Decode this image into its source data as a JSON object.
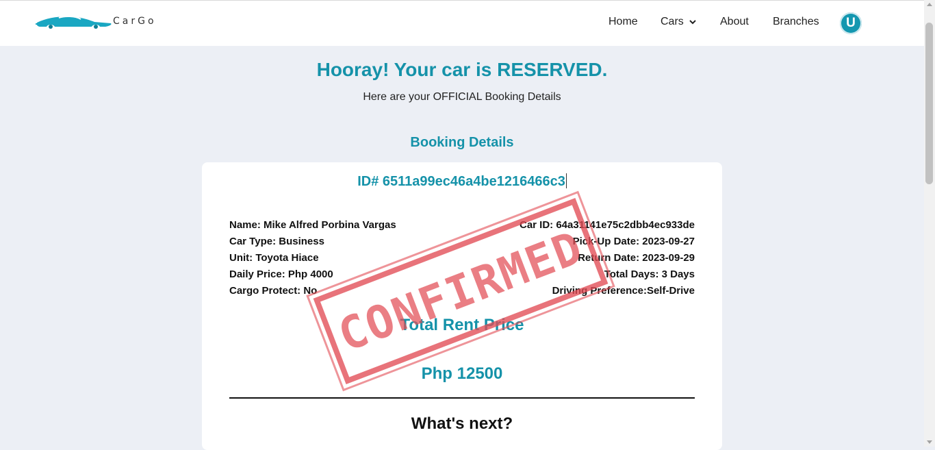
{
  "header": {
    "brand": "CarGo",
    "nav": {
      "home": "Home",
      "cars": "Cars",
      "about": "About",
      "branches": "Branches"
    },
    "avatar_initial": "U"
  },
  "main": {
    "title": "Hooray! Your car is RESERVED.",
    "subtitle": "Here are your OFFICIAL Booking Details",
    "section_heading": "Booking Details"
  },
  "booking": {
    "id": "ID# 6511a99ec46a4be1216466c3",
    "left": [
      "Name: Mike Alfred Porbina Vargas",
      "Car Type: Business",
      "Unit: Toyota Hiace",
      "Daily Price: Php 4000",
      "Cargo Protect: No"
    ],
    "right": [
      "Car ID: 64a31141e75c2dbb4ec933de",
      "Pick-Up Date: 2023-09-27",
      "Return Date: 2023-09-29",
      "Total Days: 3 Days",
      "Driving Preference:Self-Drive"
    ],
    "total_label": "Total Rent Price",
    "total_value": "Php 12500",
    "next_heading": "What's next?",
    "stamp": "CONFIRMED"
  },
  "colors": {
    "accent": "#1592a9",
    "stamp": "#e24c55",
    "background": "#eceff5"
  },
  "icons": {
    "logo": "car-silhouette-icon",
    "dropdown": "chevron-down-icon"
  }
}
